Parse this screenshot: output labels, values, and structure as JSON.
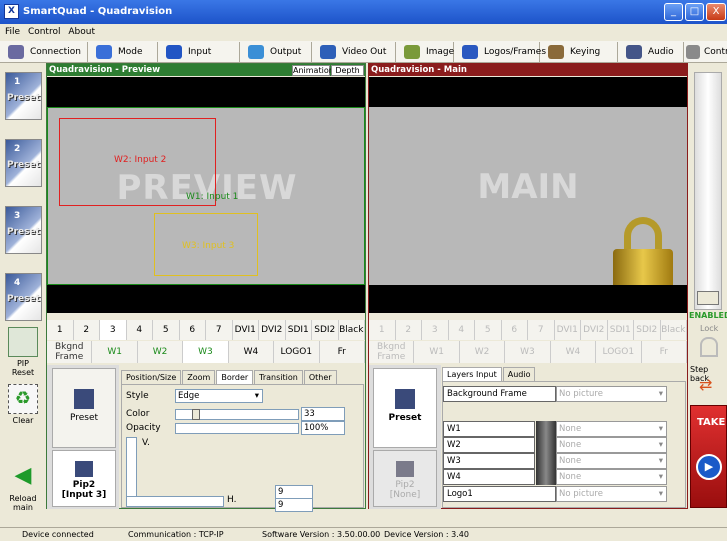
{
  "window": {
    "title": "SmartQuad - Quadravision",
    "icon": "X",
    "min": "_",
    "max": "□",
    "close": "X"
  },
  "menu": [
    "File",
    "Control",
    "About"
  ],
  "toolbar": [
    {
      "label": "Connection",
      "icon": "connection-icon",
      "color": "#6a6aa0"
    },
    {
      "label": "Mode",
      "icon": "mode-icon",
      "color": "#3a6fd8"
    },
    {
      "label": "Input",
      "icon": "input-icon",
      "color": "#2255c4"
    },
    {
      "label": "Output",
      "icon": "output-icon",
      "color": "#3b8fd6"
    },
    {
      "label": "Video Out",
      "icon": "video-out-icon",
      "color": "#2d5fb8"
    },
    {
      "label": "Image",
      "icon": "image-icon",
      "color": "#7a9a3a"
    },
    {
      "label": "Logos/Frames",
      "icon": "logos-icon",
      "color": "#2a58c0"
    },
    {
      "label": "Keying",
      "icon": "keying-icon",
      "color": "#8a6a3a"
    },
    {
      "label": "Audio",
      "icon": "audio-icon",
      "color": "#445588"
    },
    {
      "label": "Control",
      "icon": "control-icon",
      "color": "#8a8a8a"
    }
  ],
  "presets": [
    {
      "num": "1",
      "label": "Preset"
    },
    {
      "num": "2",
      "label": "Preset"
    },
    {
      "num": "3",
      "label": "Preset"
    },
    {
      "num": "4",
      "label": "Preset"
    }
  ],
  "left_buttons": {
    "pip_reset": "PIP\nReset",
    "clear": "Clear",
    "reload": "Reload\nmain"
  },
  "preview": {
    "title": "Quadravision - Preview",
    "tab1": "Animation",
    "tab2": "Depth",
    "watermark": "PREVIEW",
    "w1": "W1: Input 1",
    "w2": "W2: Input 2",
    "w3": "W3: Input 3"
  },
  "main": {
    "title": "Quadravision - Main",
    "watermark": "MAIN"
  },
  "numbers": [
    "1",
    "2",
    "3",
    "4",
    "5",
    "6",
    "7",
    "DVI1",
    "DVI2",
    "SDI1",
    "SDI2",
    "Black"
  ],
  "windows_row": [
    "Bkgnd Frame",
    "W1",
    "W2",
    "W3",
    "W4",
    "LOGO1",
    "Fr"
  ],
  "bkgnd": "Bkgnd\nFrame",
  "tabs": [
    "Position/Size",
    "Zoom",
    "Border",
    "Transition",
    "Other"
  ],
  "props": {
    "style_label": "Style",
    "style_value": "Edge",
    "color_label": "Color",
    "color_value": "33",
    "opacity_label": "Opacity",
    "opacity_value": "100%",
    "v_label": "V.",
    "h_label": "H.",
    "h_value": "9",
    "v_value": "9",
    "preset": "Preset",
    "pip": "Pip2\n[Input 3]"
  },
  "main_props": {
    "preset": "Preset",
    "pip": "Pip2\n[None]",
    "tab1": "Layers Input",
    "tab2": "Audio",
    "rows": [
      {
        "label": "Background Frame",
        "value": "No picture"
      },
      {
        "label": "W1",
        "value": "None"
      },
      {
        "label": "W2",
        "value": "None"
      },
      {
        "label": "W3",
        "value": "None"
      },
      {
        "label": "W4",
        "value": "None"
      },
      {
        "label": "Logo1",
        "value": "No picture"
      }
    ]
  },
  "right": {
    "enabled": "ENABLED",
    "lock": "Lock",
    "step_back": "Step back",
    "take": "TAKE"
  },
  "status": {
    "device": "Device connected",
    "comm": "Communication : TCP-IP",
    "sw": "Software Version : 3.50.00.00",
    "dv": "Device Version : 3.40"
  },
  "colors": {
    "preview_green": "#3c7a3c",
    "main_red": "#8a1c1c",
    "w1": "#1a8a1a",
    "w2": "#e02020",
    "w3": "#e0c020",
    "take": "#c01818"
  }
}
